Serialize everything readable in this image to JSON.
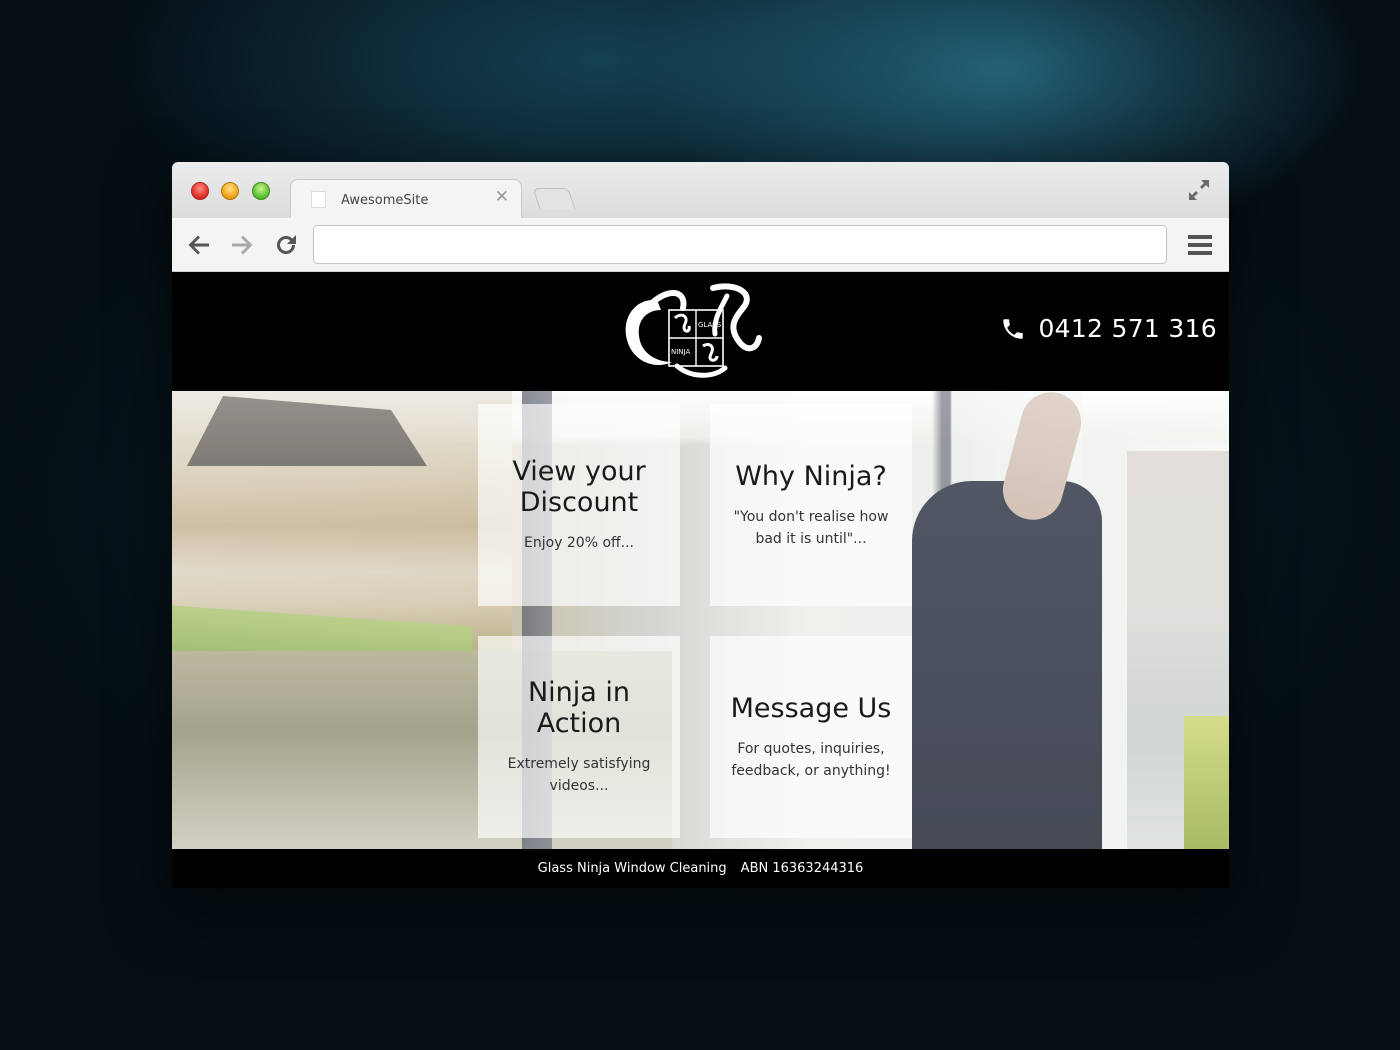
{
  "browser": {
    "tab_title": "AwesomeSite",
    "tab_close": "✕",
    "url": ""
  },
  "site": {
    "logo_text": {
      "glass": "GLASS",
      "ninja": "NINJA"
    },
    "phone": "0412 571 316",
    "cards": [
      {
        "title": "View your Discount",
        "text": "Enjoy 20% off..."
      },
      {
        "title": "Why Ninja?",
        "text": "\"You don't realise how bad it is until\"..."
      },
      {
        "title": "Ninja in Action",
        "text": "Extremely satisfying videos..."
      },
      {
        "title": "Message Us",
        "text": "For quotes, inquiries, feedback, or anything!"
      }
    ],
    "footer": {
      "company": "Glass Ninja Window Cleaning",
      "abn": "ABN 16363244316"
    }
  },
  "colors": {
    "header_bg": "#000000",
    "card_bg": "rgba(255,255,255,0.68)",
    "traffic_red": "#e0362c",
    "traffic_yellow": "#f0a81c",
    "traffic_green": "#64c43a"
  }
}
